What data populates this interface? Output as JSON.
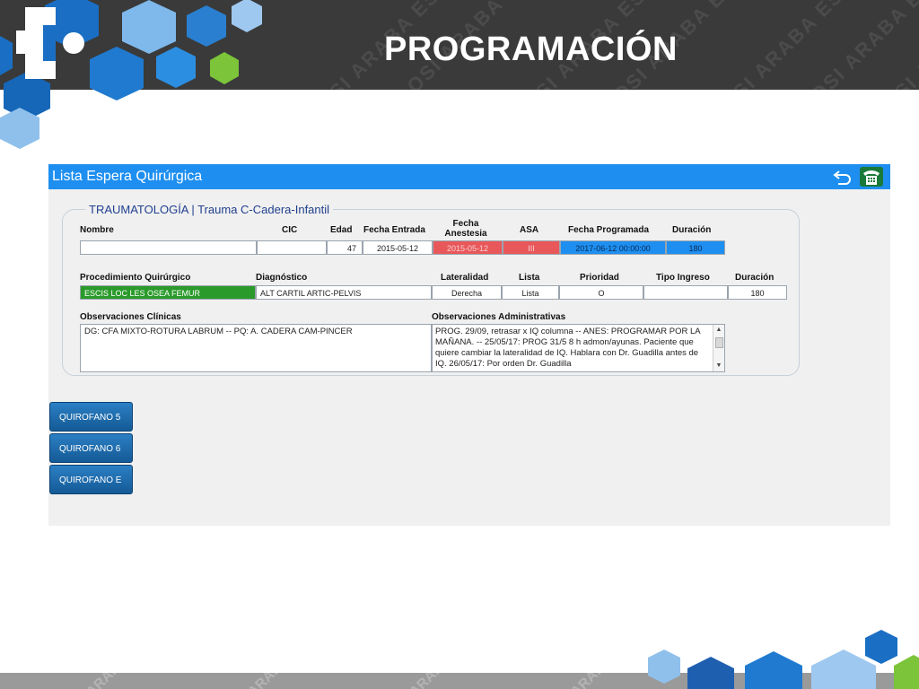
{
  "slide": {
    "title": "PROGRAMACIÓN",
    "watermark": "OSI ARABA ESI"
  },
  "app": {
    "title": "Lista Espera Quirúrgica",
    "colors": {
      "header": "#1e8ff0",
      "anesthesia_date": "#e8585b",
      "asa": "#e8585b",
      "scheduled": "#1e8ff0",
      "procedure": "#2a9a2a"
    },
    "icons": [
      "back-arrow-icon",
      "phone-icon"
    ],
    "section_title": "TRAUMATOLOGÍA | Trauma C-Cadera-Infantil",
    "row1": {
      "labels": {
        "nombre": "Nombre",
        "cic": "CIC",
        "edad": "Edad",
        "fecha_entrada": "Fecha Entrada",
        "fecha_anestesia": "Fecha Anestesia",
        "asa": "ASA",
        "fecha_programada": "Fecha Programada",
        "duracion": "Duración"
      },
      "values": {
        "nombre": "",
        "cic": "",
        "edad": "47",
        "fecha_entrada": "2015-05-12",
        "fecha_anestesia": "2015-05-12",
        "asa": "III",
        "fecha_programada": "2017-06-12 00:00:00",
        "duracion": "180"
      }
    },
    "row2": {
      "labels": {
        "procedimiento": "Procedimiento Quirúrgico",
        "diagnostico": "Diagnóstico",
        "lateralidad": "Lateralidad",
        "lista": "Lista",
        "prioridad": "Prioridad",
        "tipo_ingreso": "Tipo Ingreso",
        "duracion": "Duración"
      },
      "values": {
        "procedimiento": "ESCIS LOC LES OSEA FEMUR",
        "diagnostico": "ALT CARTIL ARTIC-PELVIS",
        "lateralidad": "Derecha",
        "lista": "Lista",
        "prioridad": "O",
        "tipo_ingreso": "",
        "duracion": "180"
      }
    },
    "observaciones": {
      "clinicas_label": "Observaciones Clínicas",
      "clinicas_text": "DG: CFA MIXTO-ROTURA LABRUM  --  PQ: A. CADERA CAM-PINCER",
      "admin_label": "Observaciones Administrativas",
      "admin_text": "PROG. 29/09, retrasar x IQ columna --  ANES: PROGRAMAR POR LA MAÑANA.  -- 25/05/17: PROG 31/5 8 h admon/ayunas. Paciente que quiere cambiar la lateralidad de IQ. Hablara con Dr. Guadilla antes de IQ. 26/05/17: Por orden Dr. Guadilla"
    },
    "quirofanos": [
      "QUIROFANO 5",
      "QUIROFANO 6",
      "QUIROFANO E"
    ]
  }
}
